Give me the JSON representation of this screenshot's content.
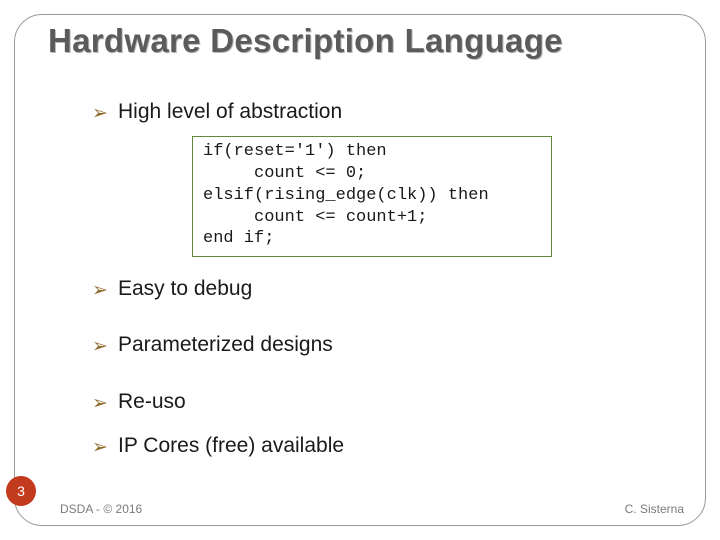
{
  "title": "Hardware Description Language",
  "bullets": {
    "b1": "High level of abstraction",
    "b2": "Easy to debug",
    "b3": "Parameterized designs",
    "b4": "Re-uso",
    "b5": "IP Cores (free) available"
  },
  "code": {
    "l1": "if(reset='1') then",
    "l2": "     count <= 0;",
    "l3": "elsif(rising_edge(clk)) then",
    "l4": "     count <= count+1;",
    "l5": "end if;"
  },
  "page_number": "3",
  "footer": {
    "left": "DSDA - © 2016",
    "right": "C. Sisterna"
  }
}
